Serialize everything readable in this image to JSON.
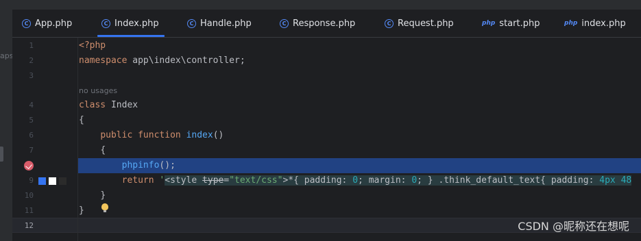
{
  "tabs": [
    {
      "label": "App.php",
      "icon": "class-icon",
      "active": false
    },
    {
      "label": "Index.php",
      "icon": "class-icon",
      "active": true
    },
    {
      "label": "Handle.php",
      "icon": "class-icon",
      "active": false
    },
    {
      "label": "Response.php",
      "icon": "class-icon",
      "active": false
    },
    {
      "label": "Request.php",
      "icon": "class-icon",
      "active": false
    },
    {
      "label": "start.php",
      "icon": "php-file-icon",
      "active": false
    },
    {
      "label": "index.php",
      "icon": "php-file-icon",
      "active": false
    }
  ],
  "icon_glyphs": {
    "class": "C",
    "php": "php"
  },
  "left_panel_text": "aps",
  "gutter": {
    "lines": [
      "1",
      "2",
      "3",
      "4",
      "5",
      "6",
      "7",
      "9",
      "10",
      "11",
      "12"
    ],
    "current_line": "12"
  },
  "code": {
    "l1": "<?php",
    "l2_kw": "namespace",
    "l2_rest": " app\\index\\controller;",
    "inlay_hint": "no usages",
    "l4_kw": "class",
    "l4_rest": " Index",
    "l5": "{",
    "l6_kw1": "public",
    "l6_kw2": "function",
    "l6_fn": "index",
    "l6_paren": "()",
    "l7": "{",
    "l8_fn": "phpinfo",
    "l8_rest": "();",
    "l9_kw": "return",
    "l9_quote": "'",
    "l9_tag_open": "<style ",
    "l9_attr": "type",
    "l9_eq": "=",
    "l9_val": "\"text/css\"",
    "l9_css1": ">*{ padding: ",
    "l9_num1": "0",
    "l9_css2": "; margin: ",
    "l9_num2": "0",
    "l9_css3": "; } .think_default_text{ padding: ",
    "l9_num3": "4px 48",
    "l10": "}",
    "l11": "}"
  },
  "colors": {
    "accent": "#3574f0",
    "keyword": "#cf8e6d",
    "function": "#56a8f5",
    "string": "#6aab73",
    "number": "#2aacb8",
    "breakpoint": "#d95c6a"
  },
  "color_swatches": [
    "#3574f0",
    "#ffffff",
    "#2b2b2b"
  ],
  "watermark": "CSDN @昵称还在想呢"
}
